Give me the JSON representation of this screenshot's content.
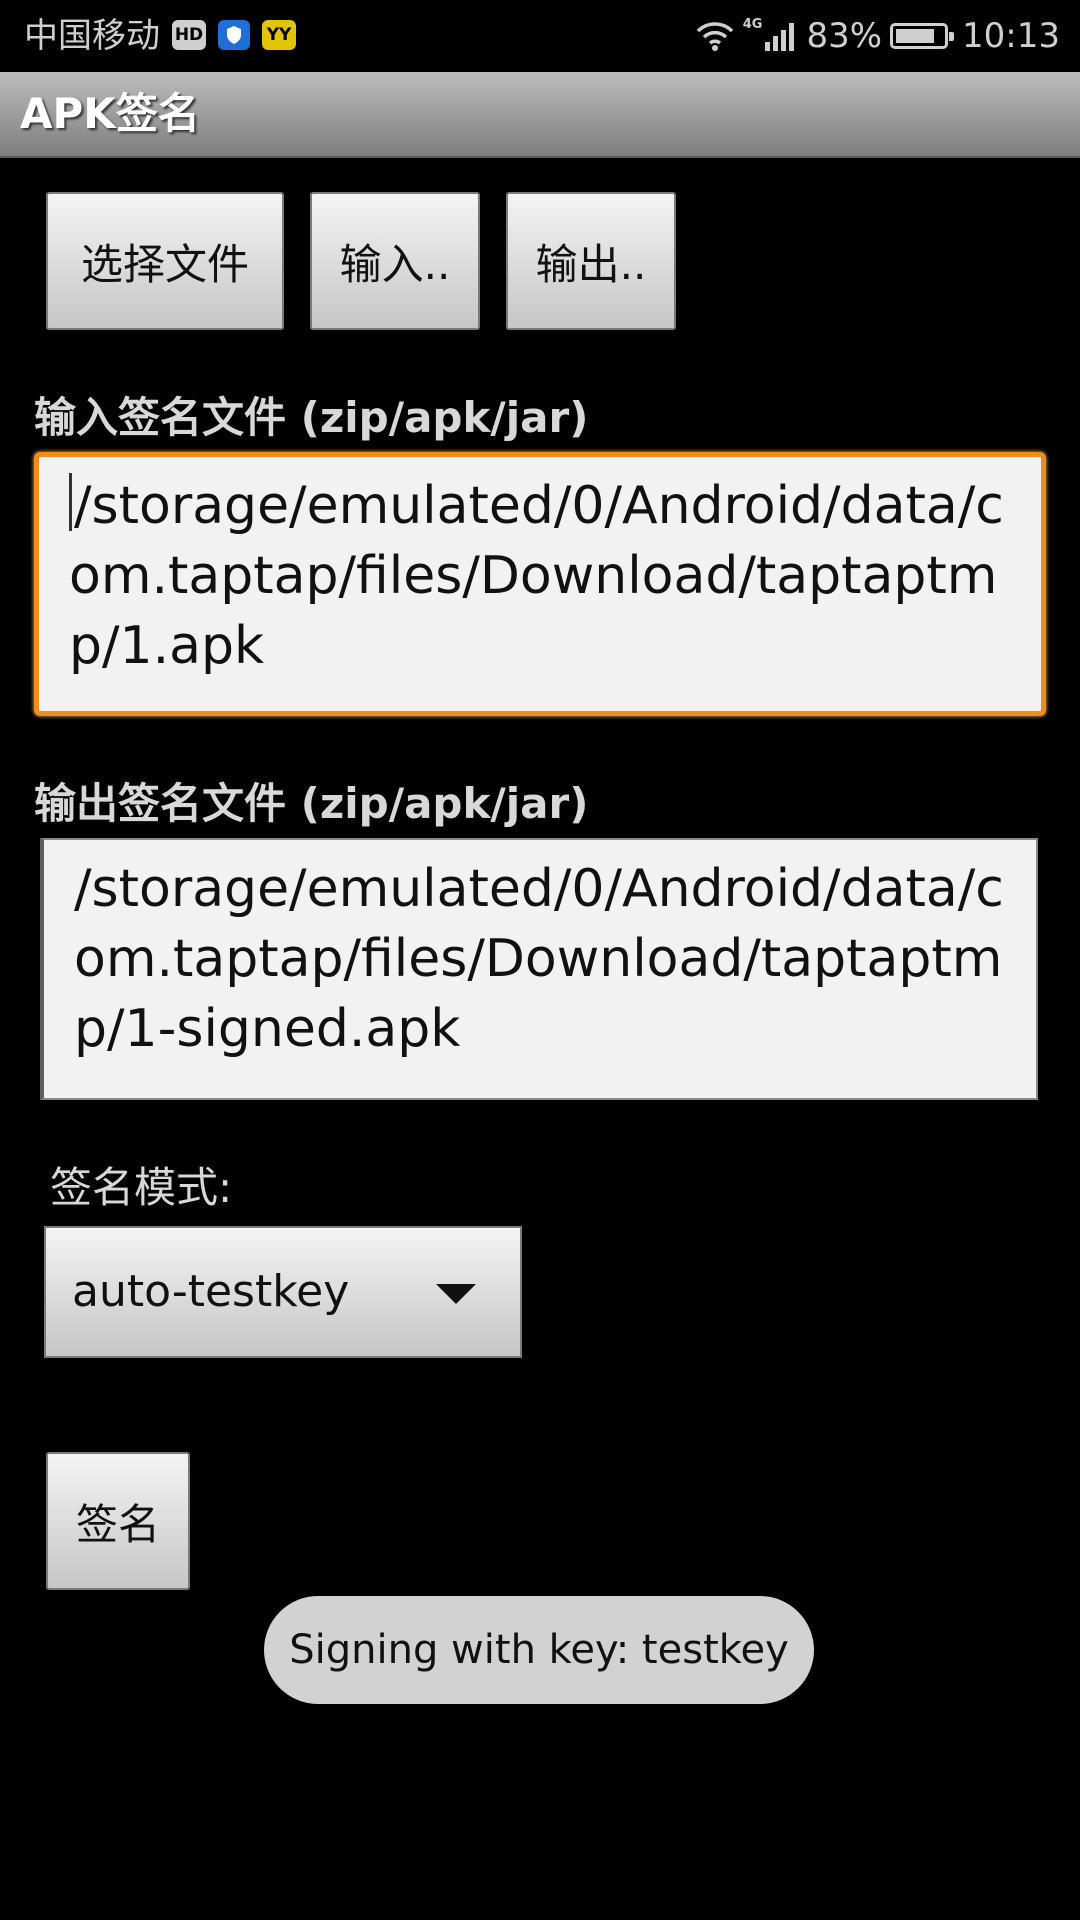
{
  "status_bar": {
    "carrier": "中国移动",
    "badges": {
      "hd": "HD",
      "yy": "YY"
    },
    "network": "4G",
    "battery": "83%",
    "battery_level": 0.83,
    "time": "10:13"
  },
  "app": {
    "title": "APK签名"
  },
  "buttons": {
    "select_file": "选择文件",
    "input": "输入..",
    "output": "输出..",
    "sign": "签名"
  },
  "input_field": {
    "label": "输入签名文件 (zip/apk/jar)",
    "value": "/storage/emulated/0/Android/data/com.taptap/files/Download/taptaptmp/1.apk"
  },
  "output_field": {
    "label": "输出签名文件 (zip/apk/jar)",
    "value": "/storage/emulated/0/Android/data/com.taptap/files/Download/taptaptmp/1-signed.apk"
  },
  "sign_mode": {
    "label": "签名模式:",
    "selected": "auto-testkey"
  },
  "toast": {
    "message": "Signing with key: testkey"
  },
  "colors": {
    "background": "#000000",
    "focus_border": "#f08c1e",
    "field_bg": "#f2f2f2",
    "toast_bg": "#d2d2d2"
  },
  "icons": [
    "hd-badge-icon",
    "shield-icon",
    "yy-icon",
    "wifi-icon",
    "signal-icon",
    "battery-icon",
    "dropdown-arrow-icon"
  ]
}
